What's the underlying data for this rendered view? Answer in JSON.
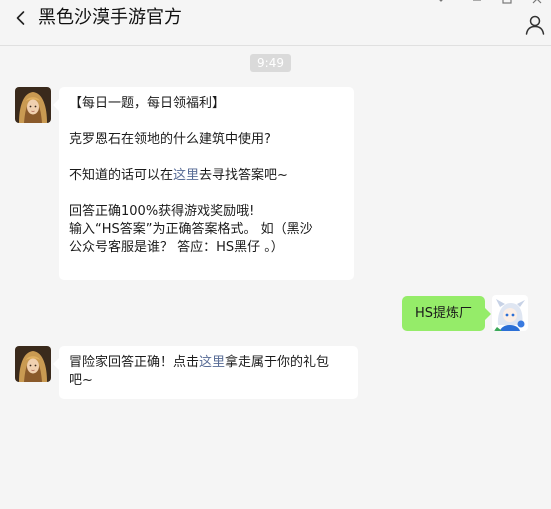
{
  "app": {
    "title": "黑色沙漠手游官方",
    "back_icon": "chevron-left-icon",
    "user_icon": "user-icon"
  },
  "chat": {
    "timestamp": "9:49",
    "messages": [
      {
        "sender": "official",
        "avatar": "game-character-avatar",
        "line1": "【每日一题，每日领福利】",
        "line2": "克罗恩石在领地的什么建筑中使用?",
        "line3_pre": "不知道的话可以在",
        "line3_link": "这里",
        "line3_post": "去寻找答案吧~",
        "line4": "回答正确100%获得游戏奖励哦!",
        "line5": "输入“HS答案”为正确答案格式。 如（黑沙",
        "line6": "公众号客服是谁？ 答应：HS黑仔 。）"
      },
      {
        "sender": "user",
        "avatar": "anime-character-avatar",
        "text": "HS提炼厂"
      },
      {
        "sender": "official",
        "avatar": "game-character-avatar",
        "line1_pre": "冒险家回答正确！点击",
        "line1_link": "这里",
        "line1_post": "拿走属于你的礼包",
        "line2": "吧~"
      }
    ]
  },
  "colors": {
    "background": "#f5f5f5",
    "bubble_official": "#ffffff",
    "bubble_user": "#95ec69",
    "link": "#576b95",
    "timestamp_bg": "#dadada"
  }
}
